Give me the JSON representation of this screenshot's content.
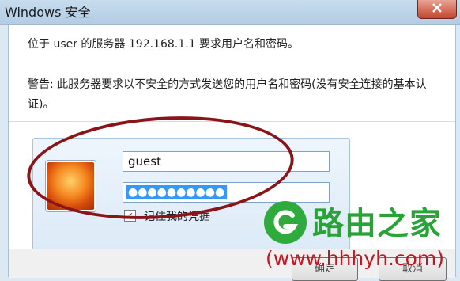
{
  "window": {
    "title": "Windows 安全"
  },
  "dialog": {
    "message": "位于 user 的服务器 192.168.1.1 要求用户名和密码。",
    "warning": "警告: 此服务器要求以不安全的方式发送您的用户名和密码(没有安全连接的基本认证)。",
    "username_value": "guest",
    "password_mask": "●●●●●●●●●●",
    "remember_label": "记住我的凭据",
    "remember_checked": true
  },
  "buttons": {
    "ok_label": "确定",
    "cancel_label": "取消"
  },
  "watermark": {
    "name": "路由之家",
    "url": "(www.hhhyh.com)"
  },
  "icons": {
    "close": "close-icon",
    "user_tile": "user-avatar-icon",
    "checkbox": "checkmark-icon",
    "logo": "router-logo-icon"
  },
  "colors": {
    "highlight": "#3399ff",
    "annotation_ellipse": "#8b1418",
    "watermark_green": "#29a338",
    "watermark_red": "#c8141c"
  }
}
